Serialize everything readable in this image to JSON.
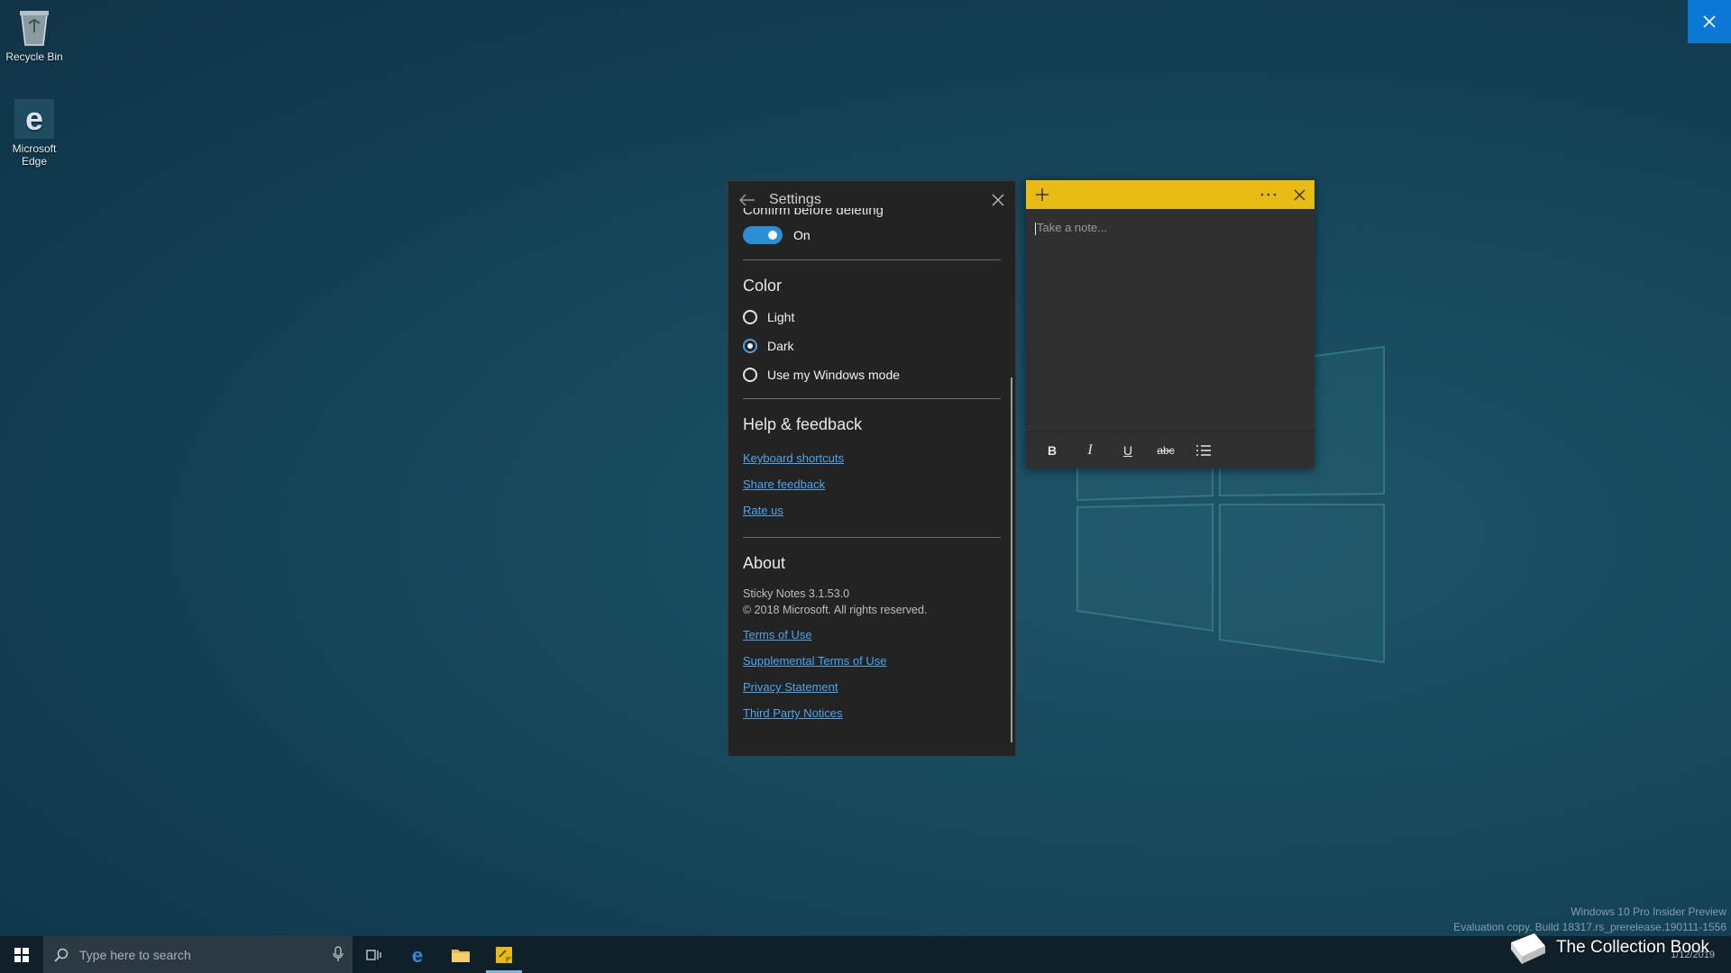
{
  "desktop": {
    "icons": [
      {
        "label": "Recycle Bin",
        "icon": "recycle-bin-icon"
      },
      {
        "label": "Microsoft Edge",
        "icon": "edge-icon"
      }
    ]
  },
  "settings": {
    "title": "Settings",
    "confirm_label_cut": "Confirm before deleting",
    "confirm_toggle_text": "On",
    "color_heading": "Color",
    "color_options": [
      {
        "label": "Light",
        "selected": false
      },
      {
        "label": "Dark",
        "selected": true
      },
      {
        "label": "Use my Windows mode",
        "selected": false
      }
    ],
    "help_heading": "Help & feedback",
    "help_links": [
      "Keyboard shortcuts",
      "Share feedback",
      "Rate us"
    ],
    "about_heading": "About",
    "about_version": "Sticky Notes 3.1.53.0",
    "about_copyright": "© 2018 Microsoft. All rights reserved.",
    "about_links": [
      "Terms of Use",
      "Supplemental Terms of Use",
      "Privacy Statement",
      "Third Party Notices"
    ]
  },
  "note": {
    "placeholder": "Take a note...",
    "accent": "#e8bb12",
    "toolbar": {
      "bold": "B",
      "italic": "I",
      "underline": "U",
      "strike": "abc"
    }
  },
  "watermark": {
    "line1": "Windows 10 Pro Insider Preview",
    "line2": "Evaluation copy. Build 18317.rs_prerelease.190111-1556",
    "brand": "The Collection Book"
  },
  "taskbar": {
    "search_placeholder": "Type here to search",
    "date": "1/12/2019"
  }
}
